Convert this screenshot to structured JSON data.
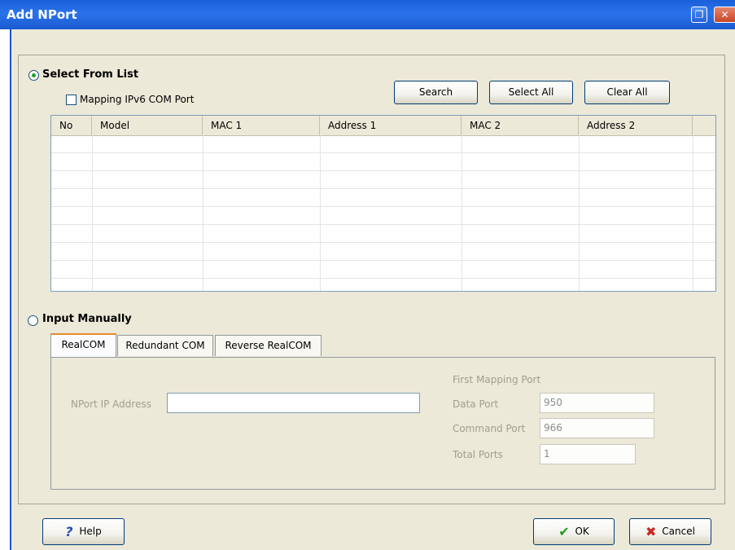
{
  "window": {
    "title": "Add NPort"
  },
  "select_from_list": {
    "label": "Select From List",
    "selected": true,
    "mapping_ipv6_label": "Mapping IPv6 COM Port",
    "mapping_ipv6_checked": false,
    "buttons": {
      "search": "Search",
      "select_all": "Select All",
      "clear_all": "Clear All"
    },
    "columns": [
      "No",
      "Model",
      "MAC 1",
      "Address 1",
      "MAC 2",
      "Address 2"
    ],
    "rows": []
  },
  "input_manually": {
    "label": "Input Manually",
    "selected": false,
    "tabs": [
      "RealCOM",
      "Redundant COM",
      "Reverse RealCOM"
    ],
    "active_tab": "RealCOM",
    "nport_ip_label": "NPort IP Address",
    "nport_ip_value": "",
    "first_mapping_port_label": "First Mapping Port",
    "data_port_label": "Data Port",
    "data_port_value": "950",
    "command_port_label": "Command Port",
    "command_port_value": "966",
    "total_ports_label": "Total Ports",
    "total_ports_value": "1"
  },
  "footer": {
    "help": "Help",
    "ok": "OK",
    "cancel": "Cancel"
  },
  "colors": {
    "titlebar": "#2464dc",
    "dialog_bg": "#ece9d8",
    "radio_dot": "#21a121",
    "ok_check": "#1e9a1e",
    "cancel_x": "#c8281e",
    "help_icon": "#1c4fb0"
  }
}
